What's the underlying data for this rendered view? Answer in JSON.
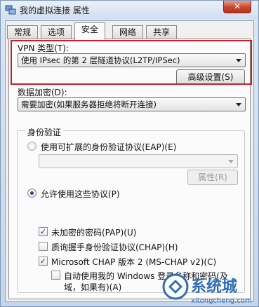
{
  "window": {
    "title": "我的虚拟连接 属性",
    "close_glyph": "✕"
  },
  "tabs": [
    {
      "label": "常规",
      "active": false
    },
    {
      "label": "选项",
      "active": false
    },
    {
      "label": "安全",
      "active": true
    },
    {
      "label": "网络",
      "active": false
    },
    {
      "label": "共享",
      "active": false
    }
  ],
  "security": {
    "vpn_type_label": "VPN 类型(T):",
    "vpn_type_value": "使用 IPsec 的第 2 层隧道协议(L2TP/IPSec)",
    "advanced_button": "高级设置(S)",
    "encryption_label": "数据加密(D):",
    "encryption_value": "需要加密(如果服务器拒绝将断开连接)",
    "auth_group_title": "身份验证",
    "eap_radio_label": "使用可扩展的身份验证协议(EAP)(E)",
    "eap_combo_value": "",
    "properties_button": "属性(R)",
    "allow_protocols_label": "允许使用这些协议(P)",
    "protocols": {
      "pap": {
        "label": "未加密的密码(PAP)(U)",
        "checked": true
      },
      "chap": {
        "label": "质询握手身份验证协议(CHAP)(H)",
        "checked": false
      },
      "mschapv2": {
        "label": "Microsoft CHAP 版本 2 (MS-CHAP v2)(C)",
        "checked": true
      },
      "autologon": {
        "label_line1": "自动使用我的 Windows 登录名称和密码(及",
        "label_line2": "域，如果有)(A)",
        "checked": false
      }
    }
  },
  "watermark": {
    "brand_cn": "系统城",
    "brand_url": "xitongcheng.com"
  },
  "colors": {
    "highlight_box": "#c8202a",
    "close_button": "#c9452f",
    "watermark_blue": "#2f6db6"
  }
}
